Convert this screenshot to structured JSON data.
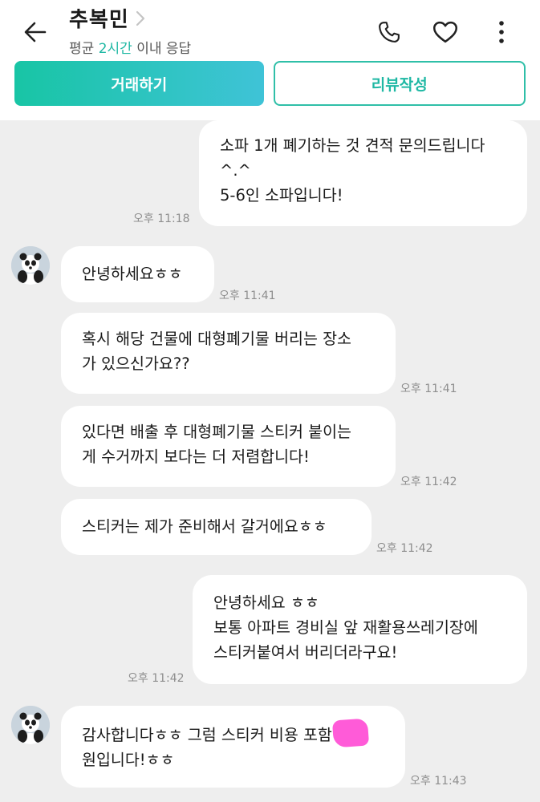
{
  "header": {
    "title": "추복민",
    "response_prefix": "평균 ",
    "response_time": "2시간",
    "response_suffix": " 이내 응답",
    "trade_button": "거래하기",
    "review_button": "리뷰작성"
  },
  "colors": {
    "accent": "#1fb8a4",
    "chat_background": "#eeeeee",
    "bubble": "#ffffff",
    "redaction": "#ff5bd8"
  },
  "icons": [
    "back-arrow-icon",
    "chevron-right-icon",
    "phone-icon",
    "heart-icon",
    "more-vertical-icon"
  ],
  "messages": [
    {
      "sender": "me",
      "text": "소파 1개 폐기하는 것 견적 문의드립니다\n^.^\n5-6인 소파입니다!",
      "time": "오후 11:18"
    },
    {
      "sender": "other",
      "text": "안녕하세요ㅎㅎ",
      "time": "오후 11:41"
    },
    {
      "sender": "other",
      "text": "혹시 해당 건물에 대형폐기물 버리는 장소\n가 있으신가요??",
      "time": "오후 11:41"
    },
    {
      "sender": "other",
      "text": "있다면 배출 후 대형폐기물 스티커 붙이는\n게 수거까지 보다는 더 저렴합니다!",
      "time": "오후 11:42"
    },
    {
      "sender": "other",
      "text": "스티커는 제가 준비해서 갈거에요ㅎㅎ",
      "time": "오후 11:42"
    },
    {
      "sender": "me",
      "text": "안녕하세요 ㅎㅎ\n보통 아파트 경비실 앞 재활용쓰레기장에\n스티커붙여서 버리더라구요!",
      "time": "오후 11:42"
    },
    {
      "sender": "other",
      "text_line1": "감사합니다ㅎㅎ 그럼 스티커 비용 포함",
      "text_line2": "원입니다!ㅎㅎ",
      "time": "오후 11:43"
    }
  ]
}
